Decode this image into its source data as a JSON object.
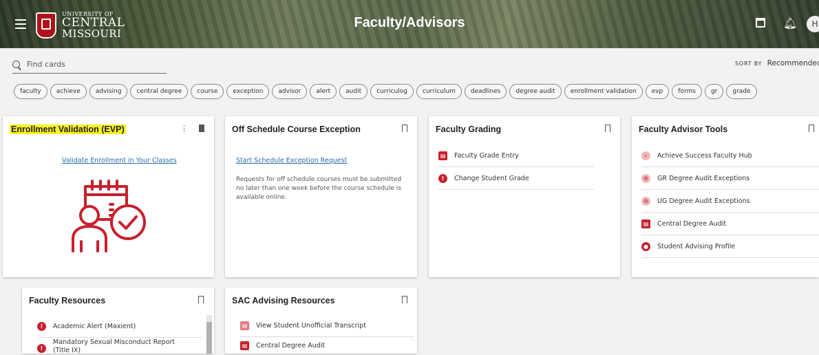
{
  "header": {
    "title": "Faculty/Advisors",
    "logo_lines": [
      "UNIVERSITY OF",
      "CENTRAL",
      "MISSOURI"
    ],
    "avatar_initial": "H",
    "icons": [
      "menu-icon",
      "calendar-icon",
      "bell-icon"
    ]
  },
  "search": {
    "placeholder": "Find cards",
    "value": ""
  },
  "sort": {
    "label": "SORT BY",
    "value": "Recommended"
  },
  "chips": [
    "faculty",
    "achieve",
    "advising",
    "central degree",
    "course",
    "exception",
    "advisor",
    "alert",
    "audit",
    "curriculog",
    "curriculum",
    "deadlines",
    "degree audit",
    "enrollment validation",
    "evp",
    "forms",
    "gr",
    "grade"
  ],
  "cards": {
    "evp": {
      "title": "Enrollment Validation (EVP)",
      "link": "Validate Enrollment in Your Classes",
      "bookmarked": true
    },
    "offschedule": {
      "title": "Off Schedule Course Exception",
      "link": "Start Schedule Exception Request",
      "desc": "Requests for off schedule courses must be submitted no later than one week before the course schedule is available online."
    },
    "grading": {
      "title": "Faculty Grading",
      "items": [
        "Faculty Grade Entry",
        "Change Student Grade"
      ]
    },
    "advisor": {
      "title": "Faculty Advisor Tools",
      "items": [
        "Achieve Success Faculty Hub",
        "GR Degree Audit Exceptions",
        "UG Degree Audit Exceptions",
        "Central Degree Audit",
        "Student Advising Profile"
      ]
    },
    "resources": {
      "title": "Faculty Resources",
      "items": [
        "Academic Alert (Maxient)",
        "Mandatory Sexual Misconduct Report (Title IX)"
      ]
    },
    "sac": {
      "title": "SAC Advising Resources",
      "items": [
        "View Student Unofficial Transcript",
        "Central Degree Audit"
      ]
    }
  },
  "colors": {
    "accent": "#c8202c",
    "link": "#2a6ab3",
    "highlight": "#f7f21e"
  }
}
